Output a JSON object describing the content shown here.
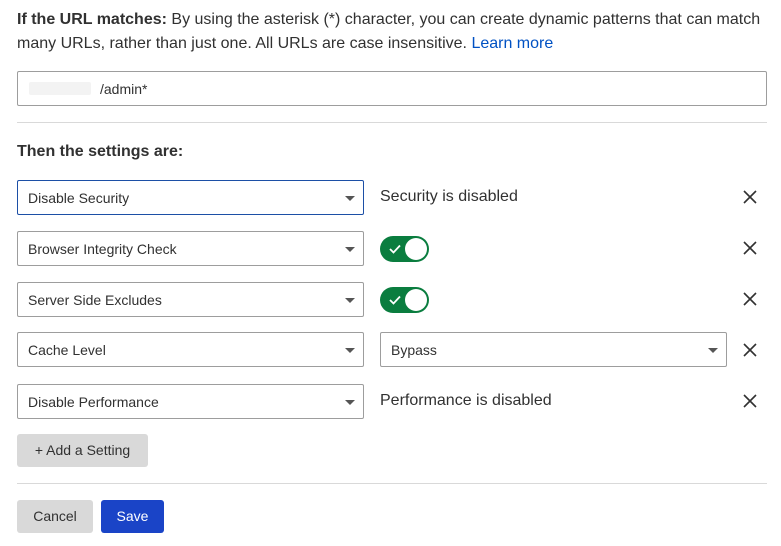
{
  "intro": {
    "bold": "If the URL matches:",
    "text": " By using the asterisk (*) character, you can create dynamic patterns that can match many URLs, rather than just one. All URLs are case insensitive. ",
    "link": "Learn more"
  },
  "url_field": {
    "value": "/admin*"
  },
  "section_title": "Then the settings are:",
  "settings": [
    {
      "setting": "Disable Security",
      "value_text": "Security is disabled"
    },
    {
      "setting": "Browser Integrity Check",
      "toggle_on": true
    },
    {
      "setting": "Server Side Excludes",
      "toggle_on": true
    },
    {
      "setting": "Cache Level",
      "value_select": "Bypass"
    },
    {
      "setting": "Disable Performance",
      "value_text": "Performance is disabled"
    }
  ],
  "buttons": {
    "add_setting": "+ Add a Setting",
    "cancel": "Cancel",
    "save": "Save"
  },
  "colors": {
    "link": "#0051c3",
    "toggle_on": "#0a7d3f",
    "save_button": "#1a44c7",
    "secondary_button": "#d9d9d9"
  },
  "icons": {
    "remove": "close-icon",
    "dropdown": "chevron-down-icon",
    "toggle_check": "check-icon"
  }
}
